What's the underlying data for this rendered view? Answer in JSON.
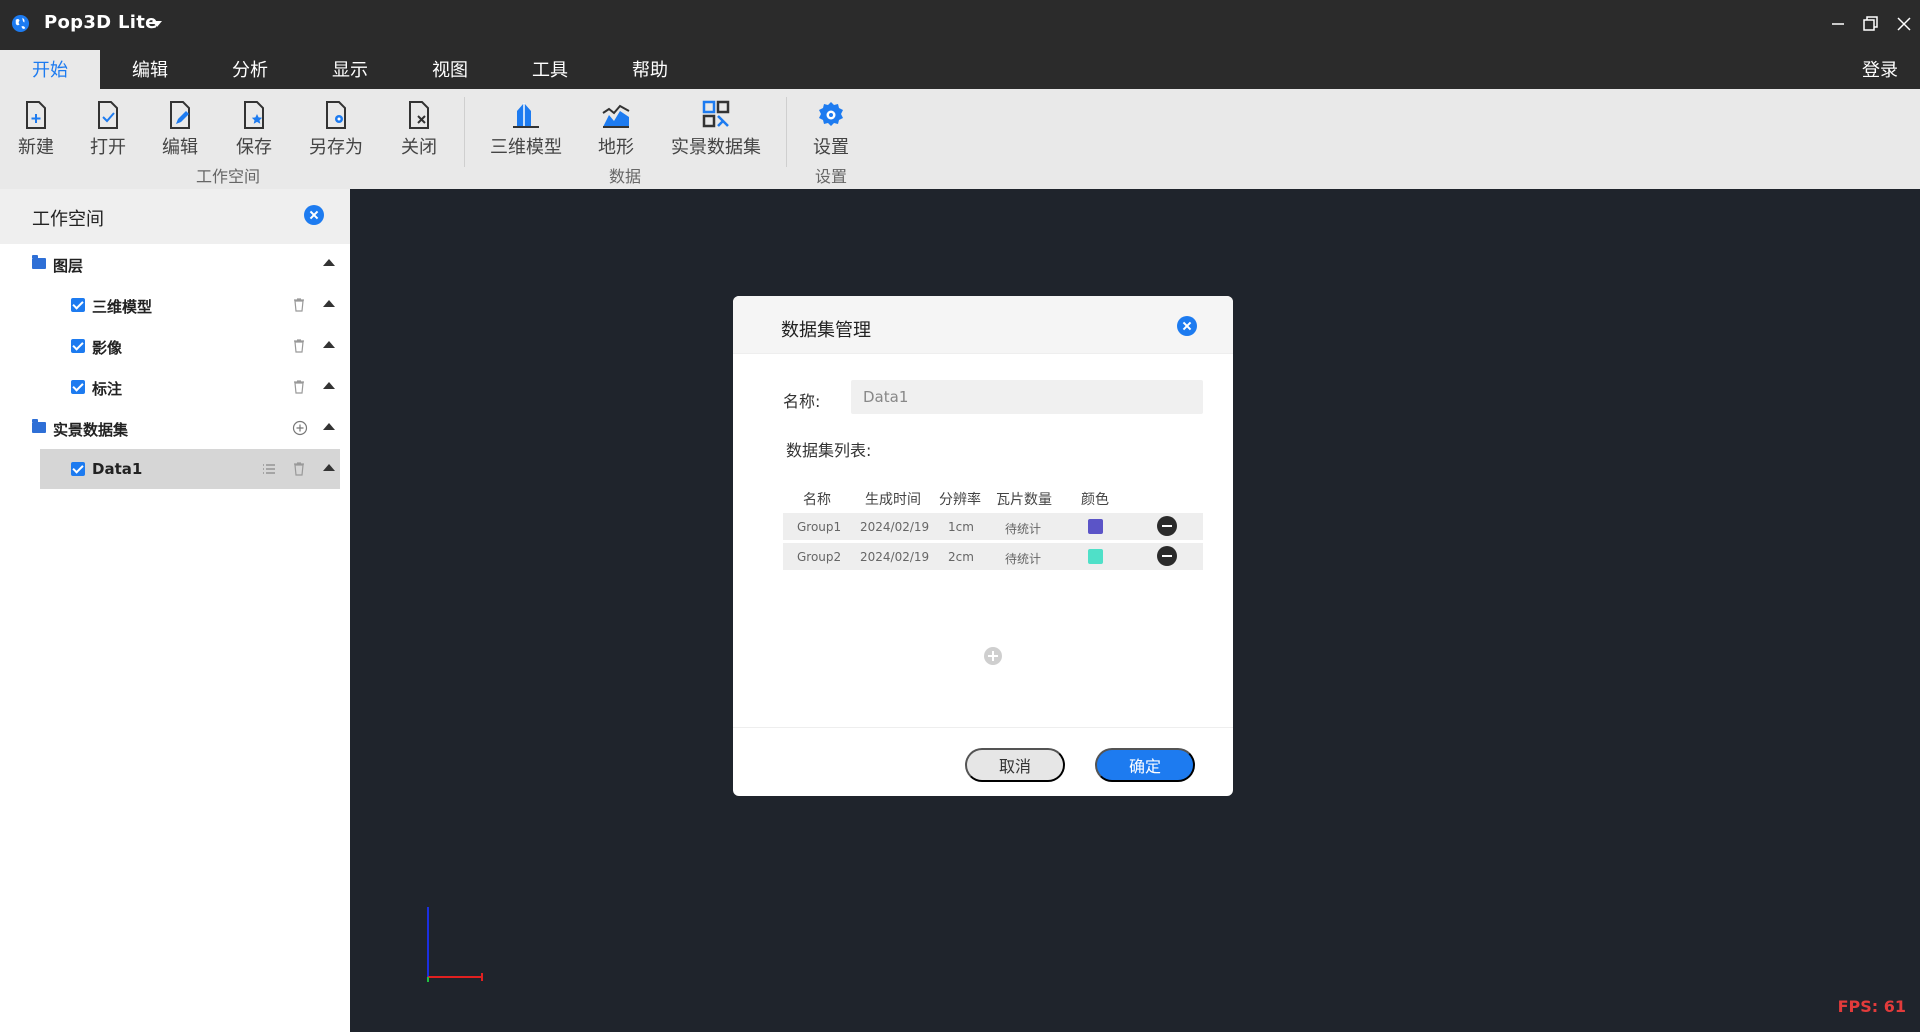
{
  "app": {
    "title": "Pop3D Lite"
  },
  "menu": {
    "tabs": [
      "开始",
      "编辑",
      "分析",
      "显示",
      "视图",
      "工具",
      "帮助"
    ],
    "login": "登录"
  },
  "ribbon": {
    "workspace": {
      "group": "工作空间",
      "buttons": [
        "新建",
        "打开",
        "编辑",
        "保存",
        "另存为",
        "关闭"
      ]
    },
    "data": {
      "group": "数据",
      "buttons": [
        "三维模型",
        "地形",
        "实景数据集"
      ]
    },
    "settings": {
      "group": "设置",
      "buttons": [
        "设置"
      ]
    }
  },
  "sidebar": {
    "title": "工作空间",
    "layers": {
      "label": "图层",
      "items": [
        "三维模型",
        "影像",
        "标注"
      ]
    },
    "datasets": {
      "label": "实景数据集",
      "items": [
        "Data1"
      ]
    }
  },
  "dialog": {
    "title": "数据集管理",
    "name_label": "名称:",
    "name_value": "Data1",
    "list_label": "数据集列表:",
    "columns": [
      "名称",
      "生成时间",
      "分辨率",
      "瓦片数量",
      "颜色"
    ],
    "rows": [
      {
        "name": "Group1",
        "time": "2024/02/19",
        "res": "1cm",
        "tiles": "待统计",
        "color": "#5b54c7"
      },
      {
        "name": "Group2",
        "time": "2024/02/19",
        "res": "2cm",
        "tiles": "待统计",
        "color": "#4fe0c8"
      }
    ],
    "cancel": "取消",
    "ok": "确定"
  },
  "viewport": {
    "fps": "FPS: 61"
  },
  "colors": {
    "accent": "#1d7bf0",
    "titlebar": "#2b2b2b",
    "viewport": "#1f242c",
    "fps": "#e23b3b"
  }
}
